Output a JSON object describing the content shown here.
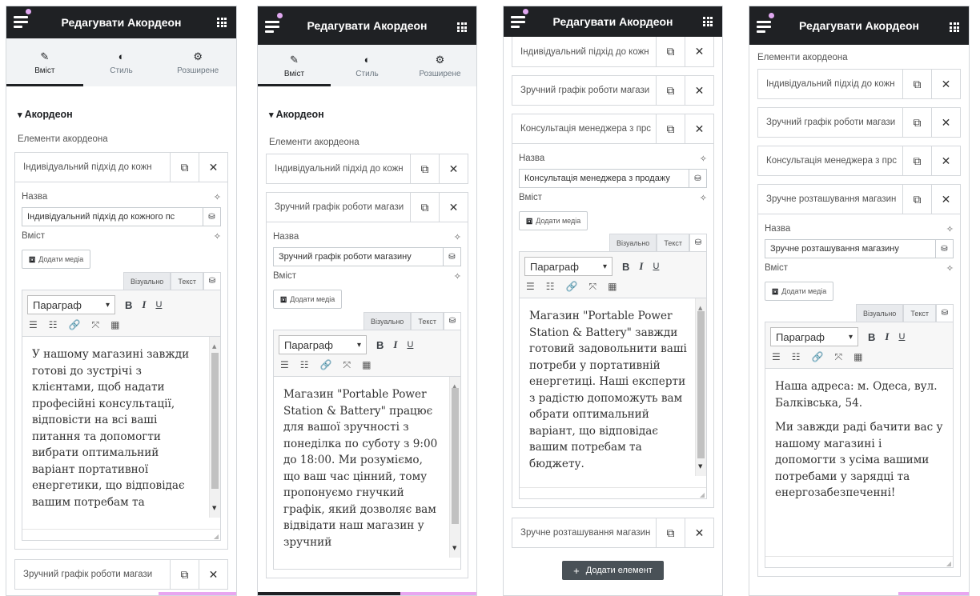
{
  "header": {
    "title": "Редагувати Акордеон"
  },
  "tabs": {
    "content": "Вміст",
    "style": "Стиль",
    "advanced": "Розширене"
  },
  "section_title": "Акордеон",
  "items_label": "Елементи акордеона",
  "items": [
    "Індивідуальний підхід до кожн",
    "Зручний графік роботи магази",
    "Консультація менеджера з прс",
    "Зручне розташування магазин"
  ],
  "field_labels": {
    "name": "Назва",
    "content": "Вміст"
  },
  "titles_full": [
    "Індивідуальний підхід до кожного пс",
    "Зручний графік роботи магазину",
    "Консультація менеджера з продажу",
    "Зручне розташування магазину"
  ],
  "editor": {
    "add_media": "Додати медіа",
    "visual": "Візуально",
    "text": "Текст",
    "paragraph": "Параграф",
    "bold": "B",
    "italic": "I",
    "underline": "U"
  },
  "add_item": "Додати елемент",
  "texts": {
    "p1": "У нашому магазині завжди готові до зустрічі з клієнтами, щоб надати професійні консультації, відповісти на всі ваші питання та допомогти вибрати оптимальний варіант портативної енергетики, що відповідає вашим потребам та",
    "p2": "Магазин \"Portable Power Station & Battery\" працює для вашої зручності з понеділка по суботу з 9:00 до 18:00. Ми розуміємо, що ваш час цінний, тому пропонуємо гнучкий графік, який дозволяє вам відвідати наш магазин у зручний",
    "p3": "Магазин \"Portable Power Station & Battery\" завжди готовий задовольнити ваші потреби у портативній енергетиці. Наші експерти з радістю допоможуть вам обрати оптимальний варіант, що відповідає вашим потребам та бюджету.",
    "p4a": "Наша адреса: м. Одеса, вул. Балківська, 54.",
    "p4b": "Ми завжди раді бачити вас у нашому магазині і допомогти з усіма вашими потребами у зарядці та енергозабезпеченні!"
  },
  "colors": {
    "header": "#1f2124",
    "accent_pink": "#e0a8f0"
  }
}
